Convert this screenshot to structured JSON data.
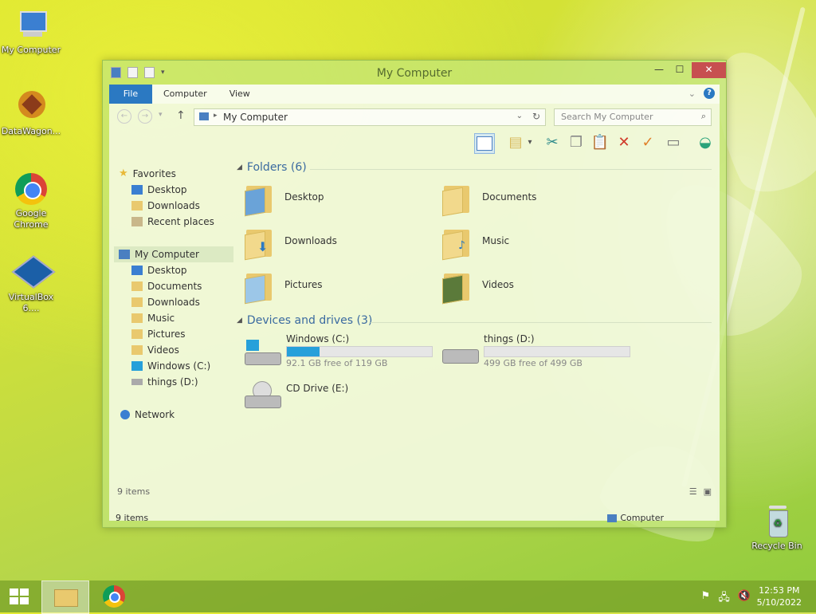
{
  "desktop": {
    "icons": [
      {
        "label": "My Computer",
        "icon": "computer-icon"
      },
      {
        "label": "DataWagon...",
        "icon": "datawagon-icon"
      },
      {
        "label": "Google Chrome",
        "icon": "chrome-icon"
      },
      {
        "label": "VirtualBox 6....",
        "icon": "virtualbox-icon"
      },
      {
        "label": "Recycle Bin",
        "icon": "recycle-bin-icon"
      }
    ]
  },
  "window": {
    "title": "My Computer",
    "controls": {
      "minimize": "—",
      "maximize": "☐",
      "close": "✕"
    },
    "ribbon_tabs": [
      "File",
      "Computer",
      "View"
    ],
    "help_label": "?",
    "address": "My Computer",
    "search_placeholder": "Search My Computer",
    "nav": {
      "favorites": "Favorites",
      "favorites_items": [
        "Desktop",
        "Downloads",
        "Recent places"
      ],
      "my_computer": "My Computer",
      "my_computer_items": [
        "Desktop",
        "Documents",
        "Downloads",
        "Music",
        "Pictures",
        "Videos",
        "Windows (C:)",
        "things (D:)"
      ],
      "network": "Network"
    },
    "folders_header": "Folders (6)",
    "folders": [
      "Desktop",
      "Documents",
      "Downloads",
      "Music",
      "Pictures",
      "Videos"
    ],
    "drives_header": "Devices and drives (3)",
    "drives": [
      {
        "name": "Windows (C:)",
        "free": "92.1 GB free of 119 GB",
        "used_fraction": 0.226
      },
      {
        "name": "things (D:)",
        "free": "499 GB free of 499 GB",
        "used_fraction": 0.0
      },
      {
        "name": "CD Drive (E:)"
      }
    ],
    "status_inner": "9 items",
    "status_left": "9 items",
    "status_right": "Computer"
  },
  "taskbar": {
    "time": "12:53 PM",
    "date": "5/10/2022"
  },
  "colors": {
    "accent": "#2b79c2",
    "drive_bar": "#26a0da",
    "close_button": "#c75050",
    "group_header": "#3a6aa0"
  }
}
